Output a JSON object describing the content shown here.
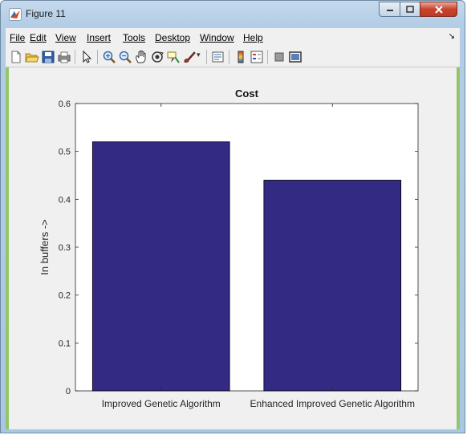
{
  "window": {
    "title": "Figure 11"
  },
  "menu": {
    "items": [
      {
        "label": "File"
      },
      {
        "label": "Edit"
      },
      {
        "label": "View"
      },
      {
        "label": "Insert"
      },
      {
        "label": "Tools"
      },
      {
        "label": "Desktop"
      },
      {
        "label": "Window"
      },
      {
        "label": "Help"
      }
    ]
  },
  "toolbar": {
    "icons": [
      "new-figure-icon",
      "open-file-icon",
      "save-icon",
      "print-icon",
      "select-arrow-icon",
      "zoom-in-icon",
      "zoom-out-icon",
      "pan-icon",
      "rotate-3d-icon",
      "data-cursor-icon",
      "brush-icon",
      "link-icon",
      "colorbar-icon",
      "legend-icon",
      "hide-plot-tools-icon",
      "show-plot-tools-icon"
    ]
  },
  "colors": {
    "bar": "#332a84",
    "accent_green": "#94c56b"
  },
  "chart_data": {
    "type": "bar",
    "title": "Cost",
    "ylabel": "In buffers ->",
    "xlabel": "",
    "categories": [
      "Improved Genetic Algorithm",
      "Enhanced Improved Genetic Algorithm"
    ],
    "values": [
      0.52,
      0.44
    ],
    "ylim": [
      0,
      0.6
    ],
    "yticks": [
      "0",
      "0.1",
      "0.2",
      "0.3",
      "0.4",
      "0.5",
      "0.6"
    ],
    "grid": false
  }
}
